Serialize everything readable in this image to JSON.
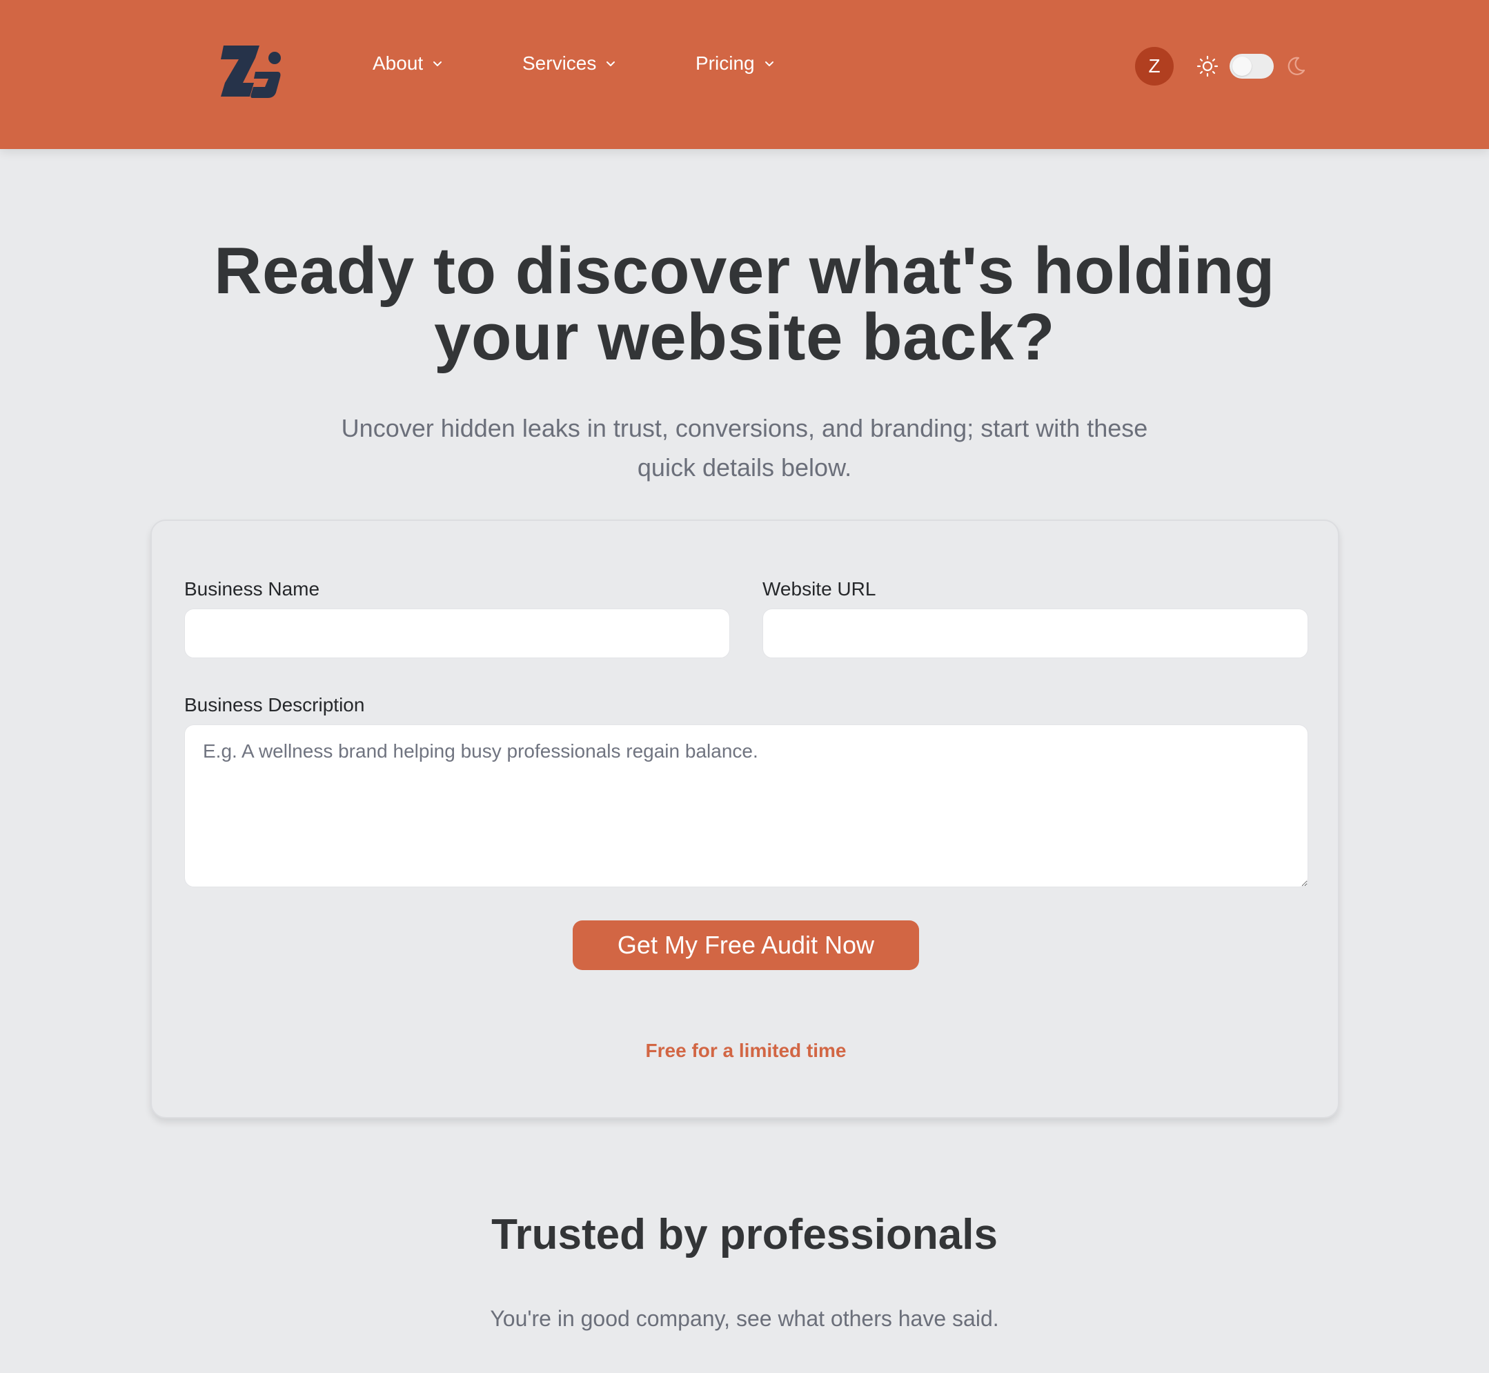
{
  "header": {
    "nav": [
      {
        "label": "About"
      },
      {
        "label": "Services"
      },
      {
        "label": "Pricing"
      }
    ],
    "avatar_initial": "Z",
    "theme_toggle": {
      "mode": "light"
    }
  },
  "hero": {
    "title": "Ready to discover what's holding your website back?",
    "subtitle": "Uncover hidden leaks in trust, conversions, and branding; start with these quick details below."
  },
  "form": {
    "business_name_label": "Business Name",
    "business_name_value": "",
    "website_url_label": "Website URL",
    "website_url_value": "",
    "description_label": "Business Description",
    "description_placeholder": "E.g. A wellness brand helping busy professionals regain balance.",
    "submit_label": "Get My Free Audit Now",
    "note": "Free for a limited time"
  },
  "trusted": {
    "title": "Trusted by professionals",
    "subtitle": "You're in good company, see what others have said."
  },
  "colors": {
    "brand": "#d26644",
    "logo": "#26334a",
    "page_background": "#e9eaec"
  }
}
